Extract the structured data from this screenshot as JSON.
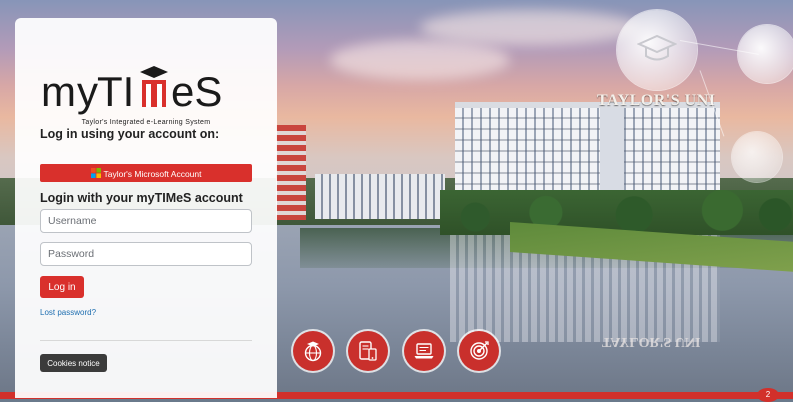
{
  "background": {
    "building_sign": "TAYLOR'S UNI",
    "reflection_sign": "TAYLOR'S UNI"
  },
  "login": {
    "logo_text": "myTIMeS",
    "tagline": "Taylor's Integrated e-Learning System",
    "sso_heading": "Log in using your account on:",
    "sso_button_label": "Taylor's Microsoft Account",
    "form_heading": "Login with your myTIMeS account",
    "username_placeholder": "Username",
    "password_placeholder": "Password",
    "login_button_label": "Log in",
    "lost_password_link": "Lost password?",
    "cookies_button_label": "Cookies notice"
  },
  "features": [
    {
      "icon": "globe-graduation-icon"
    },
    {
      "icon": "mobile-learning-icon"
    },
    {
      "icon": "laptop-icon"
    },
    {
      "icon": "target-icon"
    }
  ],
  "notification_badge": "2",
  "colors": {
    "accent": "#d9302c",
    "dark_button": "#3b3b3b",
    "link": "#1f6fb0"
  }
}
